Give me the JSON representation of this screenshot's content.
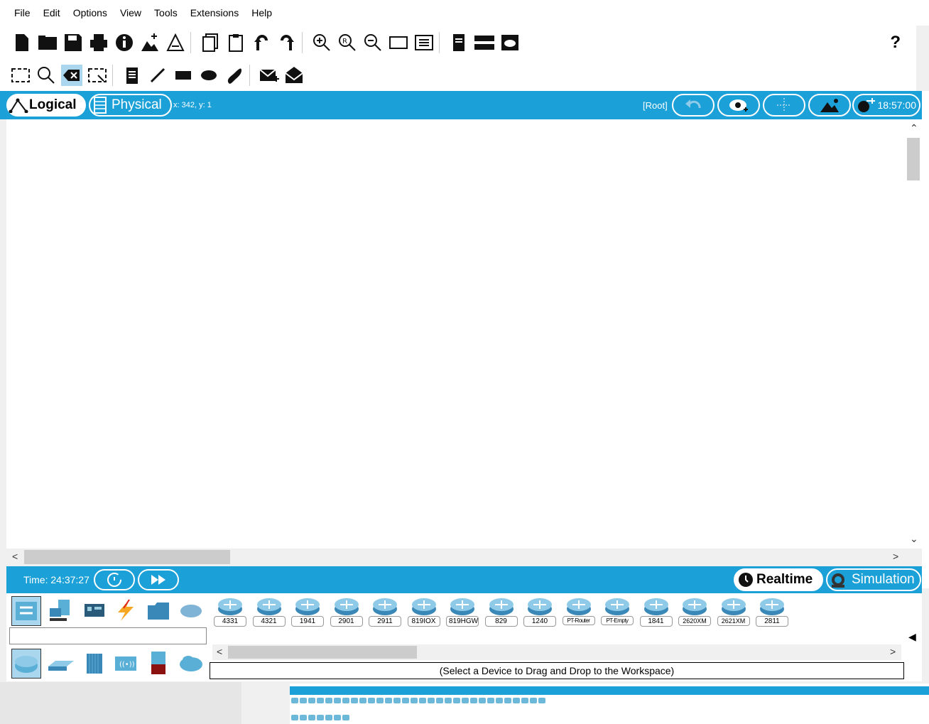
{
  "menu": [
    "File",
    "Edit",
    "Options",
    "View",
    "Tools",
    "Extensions",
    "Help"
  ],
  "toolbar1": {
    "icons": [
      "new-file-icon",
      "open-folder-icon",
      "save-icon",
      "print-icon",
      "info-icon",
      "activity-wizard-icon",
      "network-info-icon",
      "copy-icon",
      "paste-icon",
      "undo-icon",
      "redo-icon",
      "zoom-in-icon",
      "zoom-reset-icon",
      "zoom-out-icon",
      "drawing-palette-icon",
      "custom-device-icon",
      "viewport-icon",
      "ipc-icon",
      "cloud-icon"
    ],
    "help_label": "?"
  },
  "toolbar2": {
    "icons": [
      "select-icon",
      "inspect-icon",
      "delete-icon",
      "resize-icon",
      "note-icon",
      "line-icon",
      "rectangle-icon",
      "ellipse-icon",
      "freeform-icon",
      "add-simple-pdu-icon",
      "add-complex-pdu-icon"
    ]
  },
  "viewbar": {
    "logical_label": "Logical",
    "physical_label": "Physical",
    "coords": "x: 342, y: 1",
    "root_label": "[Root]",
    "clock": "18:57:00"
  },
  "bottombar": {
    "time_label": "Time: 24:37:27",
    "realtime_label": "Realtime",
    "simulation_label": "Simulation"
  },
  "device_models": [
    "4331",
    "4321",
    "1941",
    "2901",
    "2911",
    "819IOX",
    "819HGW",
    "829",
    "1240",
    "PT-Router",
    "PT-Empty",
    "1841",
    "2620XM",
    "2621XM",
    "2811"
  ],
  "hint": "(Select a Device to Drag and Drop to the Workspace)",
  "colors": {
    "accent": "#1ba0d8",
    "router": "#5aafd6"
  }
}
